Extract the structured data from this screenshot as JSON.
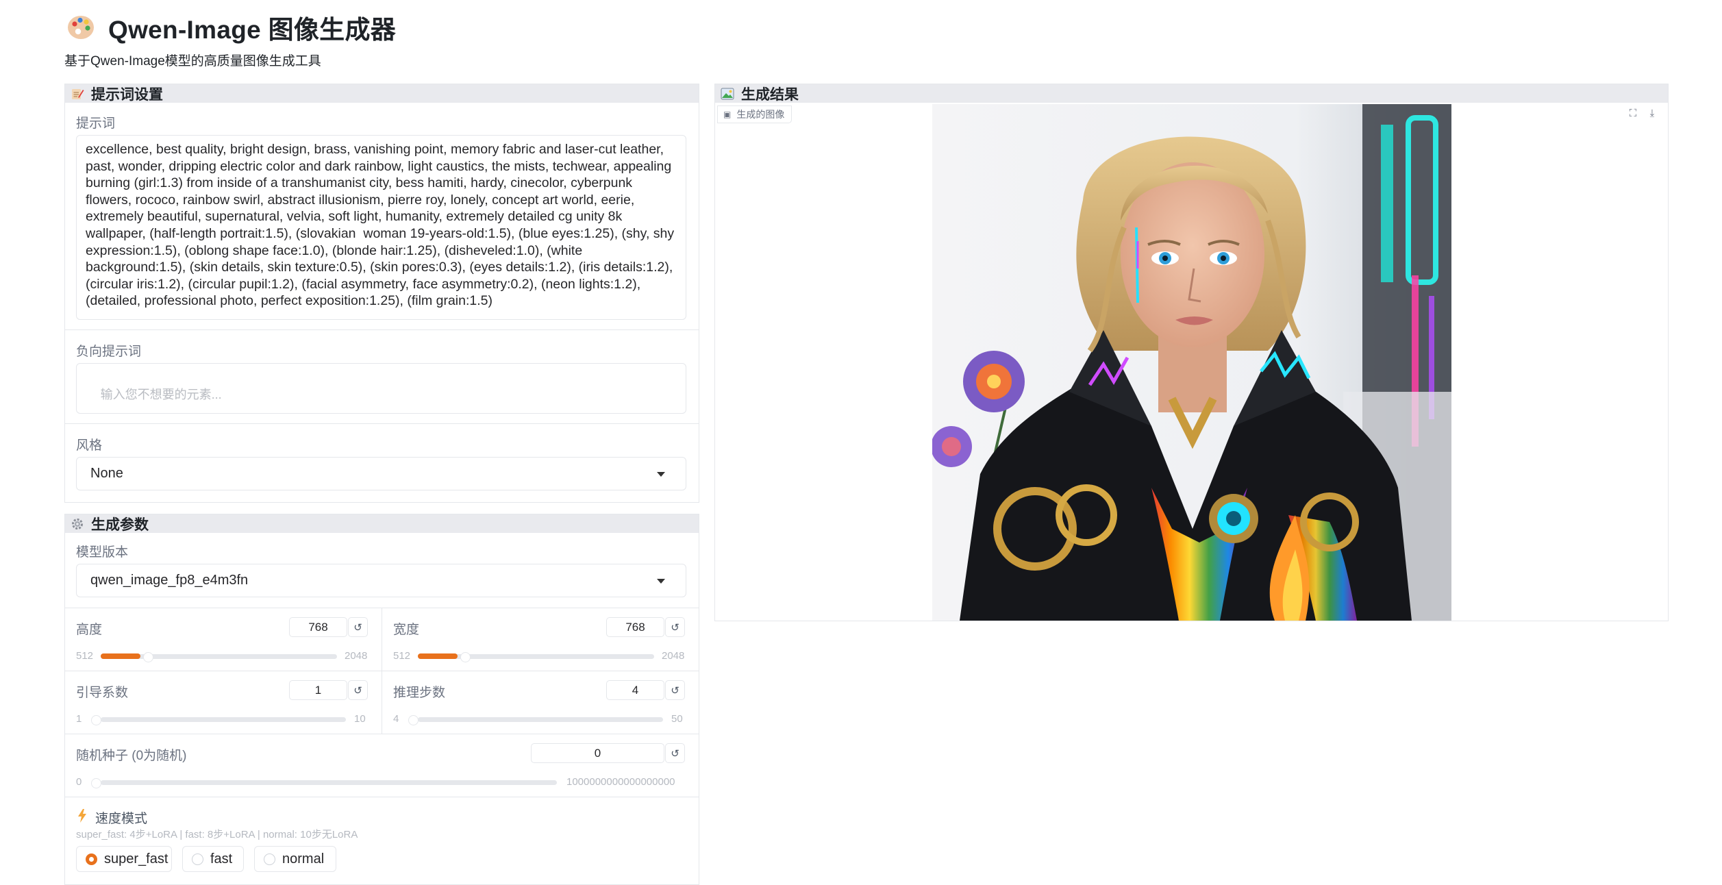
{
  "header": {
    "title": "Qwen-Image 图像生成器",
    "subtitle": "基于Qwen-Image模型的高质量图像生成工具"
  },
  "prompt_panel": {
    "title": "提示词设置",
    "prompt_label": "提示词",
    "prompt_value": "excellence, best quality, bright design, brass, vanishing point, memory fabric and laser-cut leather, past, wonder, dripping electric color and dark rainbow, light caustics, the mists, techwear, appealing burning (girl:1.3) from inside of a transhumanist city, bess hamiti, hardy, cinecolor, cyberpunk flowers, rococo, rainbow swirl, abstract illusionism, pierre roy, lonely, concept art world, eerie, extremely beautiful, supernatural, velvia, soft light, humanity, extremely detailed cg unity 8k wallpaper, (half-length portrait:1.5), (slovakian  woman 19-years-old:1.5), (blue eyes:1.25), (shy, shy expression:1.5), (oblong shape face:1.0), (blonde hair:1.25), (disheveled:1.0), (white background:1.5), (skin details, skin texture:0.5), (skin pores:0.3), (eyes details:1.2), (iris details:1.2), (circular iris:1.2), (circular pupil:1.2), (facial asymmetry, face asymmetry:0.2), (neon lights:1.2), (detailed, professional photo, perfect exposition:1.25), (film grain:1.5)",
    "negative_label": "负向提示词",
    "negative_placeholder": "输入您不想要的元素...",
    "style_label": "风格",
    "style_value": "None"
  },
  "params_panel": {
    "title": "生成参数",
    "model_label": "模型版本",
    "model_value": "qwen_image_fp8_e4m3fn",
    "height": {
      "label": "高度",
      "value": "768",
      "min": "512",
      "max": "2048",
      "fraction": 0.167
    },
    "width": {
      "label": "宽度",
      "value": "768",
      "min": "512",
      "max": "2048",
      "fraction": 0.167
    },
    "guidance": {
      "label": "引导系数",
      "value": "1",
      "min": "1",
      "max": "10",
      "fraction": 0
    },
    "steps": {
      "label": "推理步数",
      "value": "4",
      "min": "4",
      "max": "50",
      "fraction": 0
    },
    "seed": {
      "label": "随机种子 (0为随机)",
      "value": "0",
      "min": "0",
      "max": "1000000000000000000",
      "fraction": 0
    },
    "speed": {
      "label": "速度模式",
      "hint": "super_fast: 4步+LoRA | fast: 8步+LoRA | normal: 10步无LoRA",
      "options": [
        "super_fast",
        "fast",
        "normal"
      ],
      "selected": "super_fast"
    },
    "reset_glyph": "↺"
  },
  "result_panel": {
    "title": "生成结果",
    "image_label": "生成的图像",
    "fullscreen_glyph": "⛶",
    "download_glyph": "⤓"
  },
  "colors": {
    "accent": "#e8711c",
    "panel_header": "#e9eaee",
    "border": "#e5e7eb"
  }
}
